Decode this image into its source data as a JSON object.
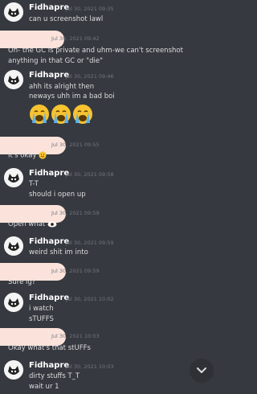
{
  "messages": [
    {
      "author": "Fidhapre",
      "time": "Jul 30, 2021 09:35",
      "lines": [
        "can u screenshot lawl"
      ]
    },
    {
      "author": "",
      "time": "Jul 30, 2021 09:42",
      "lines": [
        "Oh- the GC is private and uhm-we can't screenshot",
        "anything in that GC or \"die\""
      ]
    },
    {
      "author": "Fidhapre",
      "time": "Jul 30, 2021 09:46",
      "lines": [
        "ahh its alright then",
        "neways uhh im a bad boi"
      ]
    },
    {
      "author": "",
      "time": "Jul 30, 2021 09:55",
      "lines": [
        "It's okay"
      ]
    },
    {
      "author": "Fidhapre",
      "time": "Jul 30, 2021 09:58",
      "lines": [
        "T-T",
        "should i open up"
      ]
    },
    {
      "author": "",
      "time": "Jul 30, 2021 09:59",
      "lines": [
        "Open what"
      ]
    },
    {
      "author": "Fidhapre",
      "time": "Jul 30, 2021 09:59",
      "lines": [
        "weird shit im into"
      ]
    },
    {
      "author": "",
      "time": "Jul 30, 2021 09:59",
      "lines": [
        "Sure ig?"
      ]
    },
    {
      "author": "Fidhapre",
      "time": "Jul 30, 2021 10:02",
      "lines": [
        "i watch",
        "sTUFFS"
      ]
    },
    {
      "author": "",
      "time": "Jul 30, 2021 10:03",
      "lines": [
        "Okay what's that stUFFs"
      ]
    },
    {
      "author": "Fidhapre",
      "time": "Jul 30, 2021 10:03",
      "lines": [
        "dirty stuffs T_T",
        "wait ur 1"
      ]
    }
  ],
  "icons": {
    "crying_emoji": "loudly-crying-face",
    "smile_emoji": "smiling-face",
    "eyes_emoji": "eye",
    "scroll_down": "chevron-down"
  },
  "colors": {
    "background": "#36393f",
    "redaction": "#fbe3db",
    "author": "#ffffff",
    "timestamp": "#72767d"
  }
}
